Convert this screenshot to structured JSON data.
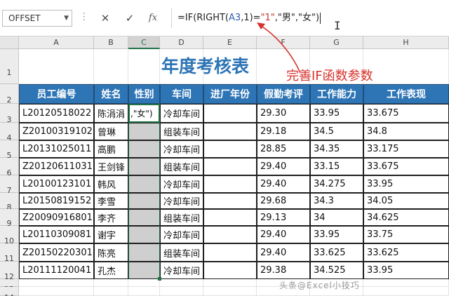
{
  "formula_bar": {
    "name_box": "OFFSET",
    "cancel_icon": "cross-icon",
    "enter_icon": "check-icon",
    "fx_label": "fx",
    "formula_prefix": "=IF(RIGHT(",
    "formula_ref": "A3",
    "formula_mid": ",1)=",
    "formula_str": "\"1\"",
    "formula_suffix": ",\"男\",\"女\")"
  },
  "columns": [
    "A",
    "B",
    "C",
    "D",
    "E",
    "F",
    "G",
    "H"
  ],
  "rows": [
    "1",
    "2",
    "3",
    "4",
    "5",
    "6",
    "7",
    "8",
    "9",
    "10",
    "11",
    "12",
    "13",
    "14"
  ],
  "sheet": {
    "title": "年度考核表",
    "annotation": "完善IF函数参数",
    "headers": [
      "员工编号",
      "姓名",
      "性别",
      "车间",
      "进厂年份",
      "假勤考评",
      "工作能力",
      "工作表现"
    ],
    "active_cell_text": ",\"女\")",
    "records": [
      [
        "L20120518022",
        "陈涓涓",
        "",
        "冷却车间",
        "",
        "29.30",
        "33.95",
        "33.675"
      ],
      [
        "Z20100319102",
        "曾琳",
        "",
        "组装车间",
        "",
        "29.18",
        "34.5",
        "34.8"
      ],
      [
        "L20131025011",
        "高鹏",
        "",
        "冷却车间",
        "",
        "28.85",
        "34.35",
        "33.175"
      ],
      [
        "Z20120611031",
        "王剑锋",
        "",
        "组装车间",
        "",
        "29.40",
        "33.15",
        "33.675"
      ],
      [
        "L20100123101",
        "韩风",
        "",
        "冷却车间",
        "",
        "29.40",
        "34.275",
        "33.95"
      ],
      [
        "L20150819152",
        "李雪",
        "",
        "冷却车间",
        "",
        "29.68",
        "34.3",
        "34.05"
      ],
      [
        "Z20090916801",
        "李齐",
        "",
        "组装车间",
        "",
        "29.13",
        "34",
        "34.625"
      ],
      [
        "L20110309081",
        "谢宇",
        "",
        "冷却车间",
        "",
        "29.40",
        "33.95",
        "33.75"
      ],
      [
        "Z20150220301",
        "陈亮",
        "",
        "组装车间",
        "",
        "29.40",
        "33.625",
        "33.625"
      ],
      [
        "L20111120041",
        "孔杰",
        "",
        "冷却车间",
        "",
        "29.38",
        "34.525",
        "33.95"
      ]
    ]
  },
  "colors": {
    "header_fill": "#2e75b6",
    "title": "#2e75b6",
    "annotation": "#d7322c",
    "selection": "#217346"
  },
  "watermark": "头条@Excel小技巧"
}
